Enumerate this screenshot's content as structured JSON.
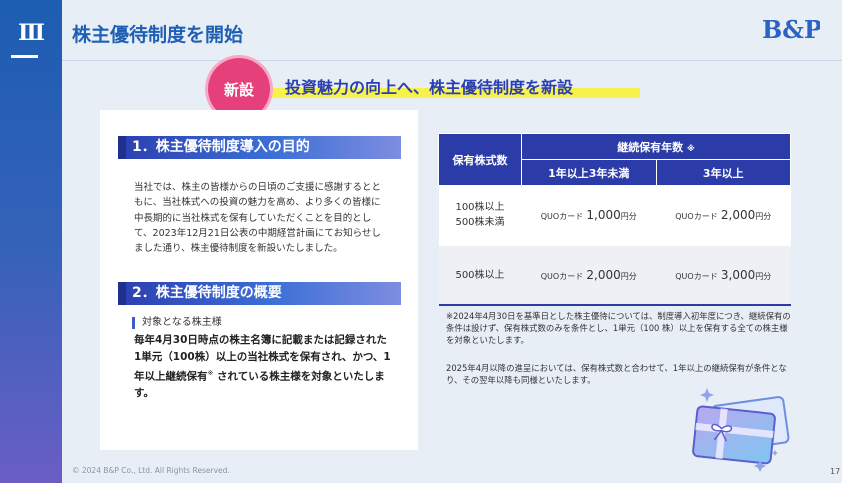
{
  "section_numeral": "Ⅲ",
  "page_title": "株主優待制度を開始",
  "badge": "新設",
  "headline": "投資魅力の向上へ、株主優待制度を新設",
  "section1": {
    "heading": "1．株主優待制度導入の目的",
    "body": "当社では、株主の皆様からの日頃のご支援に感謝するとともに、当社株式への投資の魅力を高め、より多くの皆様に中長期的に当社株式を保有していただくことを目的として、2023年12月21日公表の中期経営計画にてお知らせしました通り、株主優待制度を新設いたしました。"
  },
  "section2": {
    "heading": "2．株主優待制度の概要",
    "sub_label": "対象となる株主様",
    "body_before_mark": "毎年4月30日時点の株主名簿に記載または記録された1単元（100株）以上の当社株式を保有され、かつ、1年以上継続保有",
    "mark": "※",
    "body_after_mark": " されている株主様を対象といたします。"
  },
  "table": {
    "col_shares": "保有株式数",
    "col_period": "継続保有年数",
    "col_period_mark": "※",
    "col_a": "1年以上3年未満",
    "col_b": "3年以上",
    "rows": [
      {
        "share_line1": "100株以上",
        "share_line2": "500株未満",
        "a_prefix": "QUOカード",
        "a_value": "1,000",
        "a_unit": "円分",
        "b_prefix": "QUOカード",
        "b_value": "2,000",
        "b_unit": "円分"
      },
      {
        "share_line1": "500株以上",
        "share_line2": "",
        "a_prefix": "QUOカード",
        "a_value": "2,000",
        "a_unit": "円分",
        "b_prefix": "QUOカード",
        "b_value": "3,000",
        "b_unit": "円分"
      }
    ]
  },
  "note1": "※2024年4月30日を基準日とした株主優待については、制度導入初年度につき、継続保有の条件は設けず、保有株式数のみを条件とし、1単元（100 株）以上を保有する全ての株主様を対象といたします。",
  "note2": "2025年4月以降の進呈においては、保有株式数と合わせて、1年以上の継続保有が条件となり、その翌年以降も同様といたします。",
  "footer": "© 2024 B&P Co., Ltd. All Rights Reserved.",
  "page_number": "17",
  "logo_text": "B&P",
  "colors": {
    "primary": "#2b3ca8",
    "accent_pink": "#e6407a",
    "highlight": "#f7f24b",
    "title_blue": "#1f5fb4"
  }
}
